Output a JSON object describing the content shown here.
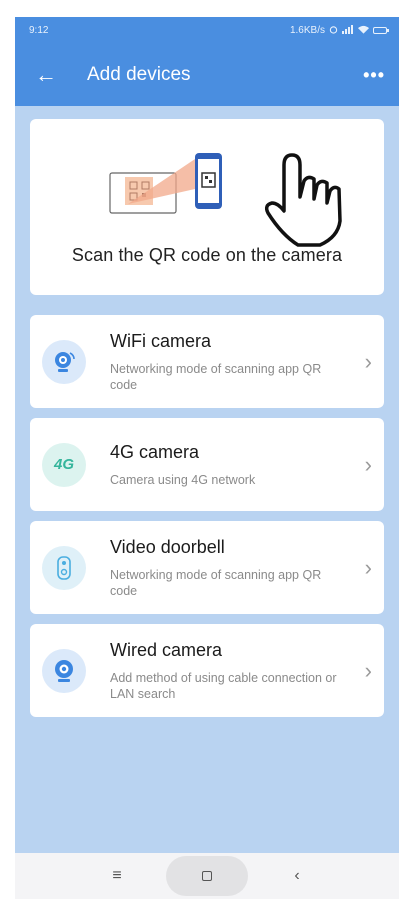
{
  "status_bar": {
    "time": "9:12",
    "right_text": "1.6KB/s",
    "icons": [
      "alarm-icon",
      "signal-icon",
      "wifi-icon",
      "battery-icon"
    ]
  },
  "app_bar": {
    "title": "Add devices",
    "back_icon": "arrow-left-icon",
    "more_icon": "more-dots-icon",
    "back_glyph": "←",
    "more_glyph": "•••"
  },
  "scan_card": {
    "label": "Scan the QR code on the camera"
  },
  "devices": [
    {
      "title": "WiFi camera",
      "description": "Networking mode of scanning app QR code",
      "icon": "wifi-camera-icon",
      "icon_bg": "#dbe9fa"
    },
    {
      "title": "4G camera",
      "description": "Camera using 4G network",
      "icon": "4g-icon",
      "icon_bg": "#dcf3ef",
      "icon_text": "4G"
    },
    {
      "title": "Video doorbell",
      "description": "Networking mode of scanning app QR code",
      "icon": "doorbell-icon",
      "icon_bg": "#dff0f8"
    },
    {
      "title": "Wired camera",
      "description": "Add method of using cable connection or LAN search",
      "icon": "wired-camera-icon",
      "icon_bg": "#dbe9fa"
    }
  ],
  "chevron_glyph": "›",
  "nav_bar": {
    "menu_glyph": "≡",
    "back_glyph": "‹"
  },
  "colors": {
    "header_blue": "#4a8ee0",
    "page_bg": "#b9d3f1",
    "card_bg": "#ffffff"
  }
}
